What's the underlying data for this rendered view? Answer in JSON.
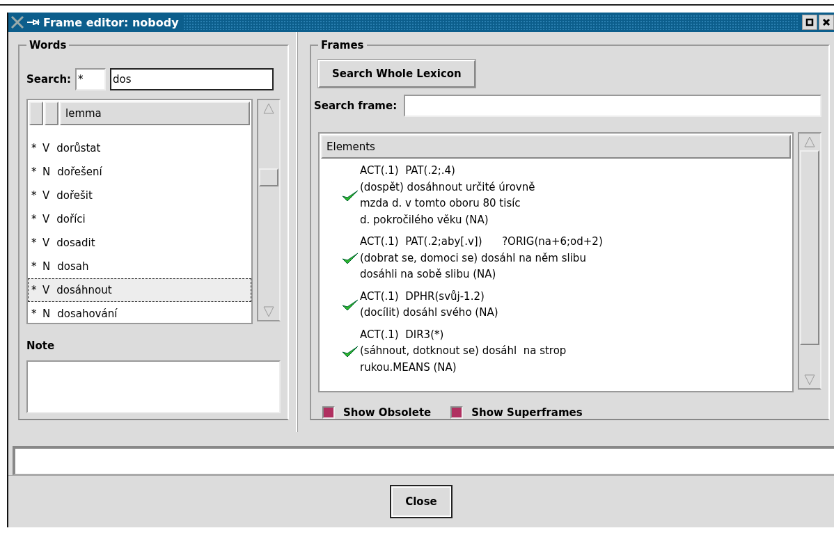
{
  "window": {
    "title": "Frame editor: nobody"
  },
  "words": {
    "title": "Words",
    "search_label": "Search:",
    "search_prefix": "*",
    "search_value": "dos",
    "column": "lemma",
    "rows": [
      {
        "mark": "*",
        "pos": "V",
        "lemma": "dorůstat",
        "selected": false
      },
      {
        "mark": "*",
        "pos": "N",
        "lemma": "dořešení",
        "selected": false
      },
      {
        "mark": "*",
        "pos": "V",
        "lemma": "dořešit",
        "selected": false
      },
      {
        "mark": "*",
        "pos": "V",
        "lemma": "doříci",
        "selected": false
      },
      {
        "mark": "*",
        "pos": "V",
        "lemma": "dosadit",
        "selected": false
      },
      {
        "mark": "*",
        "pos": "N",
        "lemma": "dosah",
        "selected": false
      },
      {
        "mark": "*",
        "pos": "V",
        "lemma": "dosáhnout",
        "selected": true
      },
      {
        "mark": "*",
        "pos": "N",
        "lemma": "dosahování",
        "selected": false
      }
    ],
    "note_label": "Note"
  },
  "frames": {
    "title": "Frames",
    "search_button": "Search Whole Lexicon",
    "search_label": "Search frame:",
    "column": "Elements",
    "items": [
      {
        "approved": true,
        "lines": [
          "ACT(.1)  PAT(.2;.4)",
          "(dospět) dosáhnout určité úrovně",
          "mzda d. v tomto oboru 80 tisíc",
          "d. pokročilého věku (NA)"
        ]
      },
      {
        "approved": true,
        "lines": [
          "ACT(.1)  PAT(.2;aby[.v])      ?ORIG(na+6;od+2)",
          "(dobrat se, domoci se) dosáhl na něm slibu",
          "dosáhli na sobě slibu (NA)"
        ]
      },
      {
        "approved": true,
        "lines": [
          "ACT(.1)  DPHR(svůj-1.2)",
          "(docílit) dosáhl svého (NA)"
        ]
      },
      {
        "approved": true,
        "lines": [
          "ACT(.1)  DIR3(*)",
          "(sáhnout, dotknout se) dosáhl  na strop",
          "rukou.MEANS (NA)"
        ]
      }
    ],
    "options": [
      {
        "label": "Show Obsolete",
        "checked": true
      },
      {
        "label": "Show Superframes",
        "checked": true
      }
    ]
  },
  "close_button": "Close"
}
